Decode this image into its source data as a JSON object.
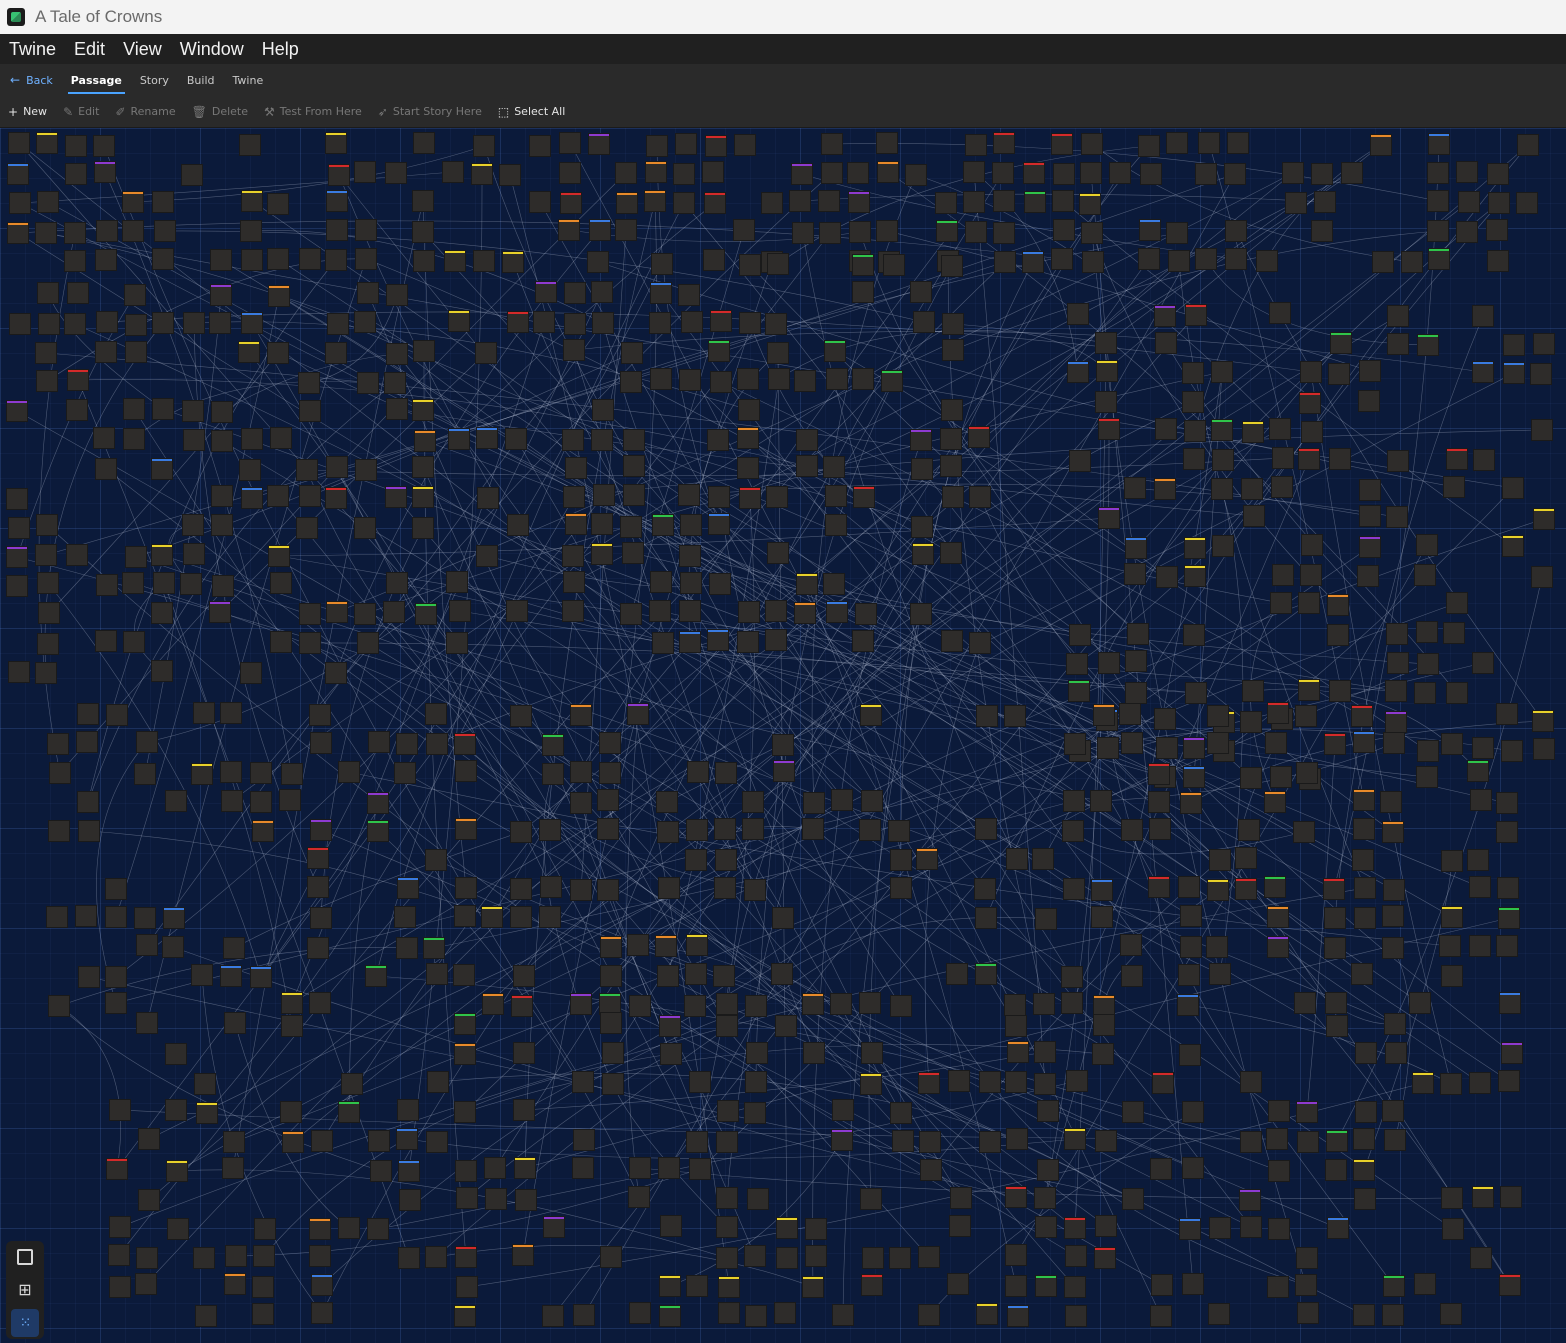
{
  "window": {
    "title": "A Tale of Crowns"
  },
  "menu": [
    "Twine",
    "Edit",
    "View",
    "Window",
    "Help"
  ],
  "tabs": {
    "back": "Back",
    "items": [
      "Passage",
      "Story",
      "Build",
      "Twine"
    ],
    "active": "Passage"
  },
  "toolbar": {
    "new": "New",
    "edit": "Edit",
    "rename": "Rename",
    "delete": "Delete",
    "test_from_here": "Test From Here",
    "start_story_here": "Start Story Here",
    "select_all": "Select All"
  },
  "tag_colors": [
    "#d42a2a",
    "#e8d12a",
    "#2fc44a",
    "#3a7be0",
    "#8e3ad0",
    "#e88a2a"
  ],
  "zoom": {
    "levels": [
      "passage-names-and-excerpts",
      "passage-names-only",
      "passage-structure-only"
    ],
    "selected": "passage-structure-only"
  }
}
